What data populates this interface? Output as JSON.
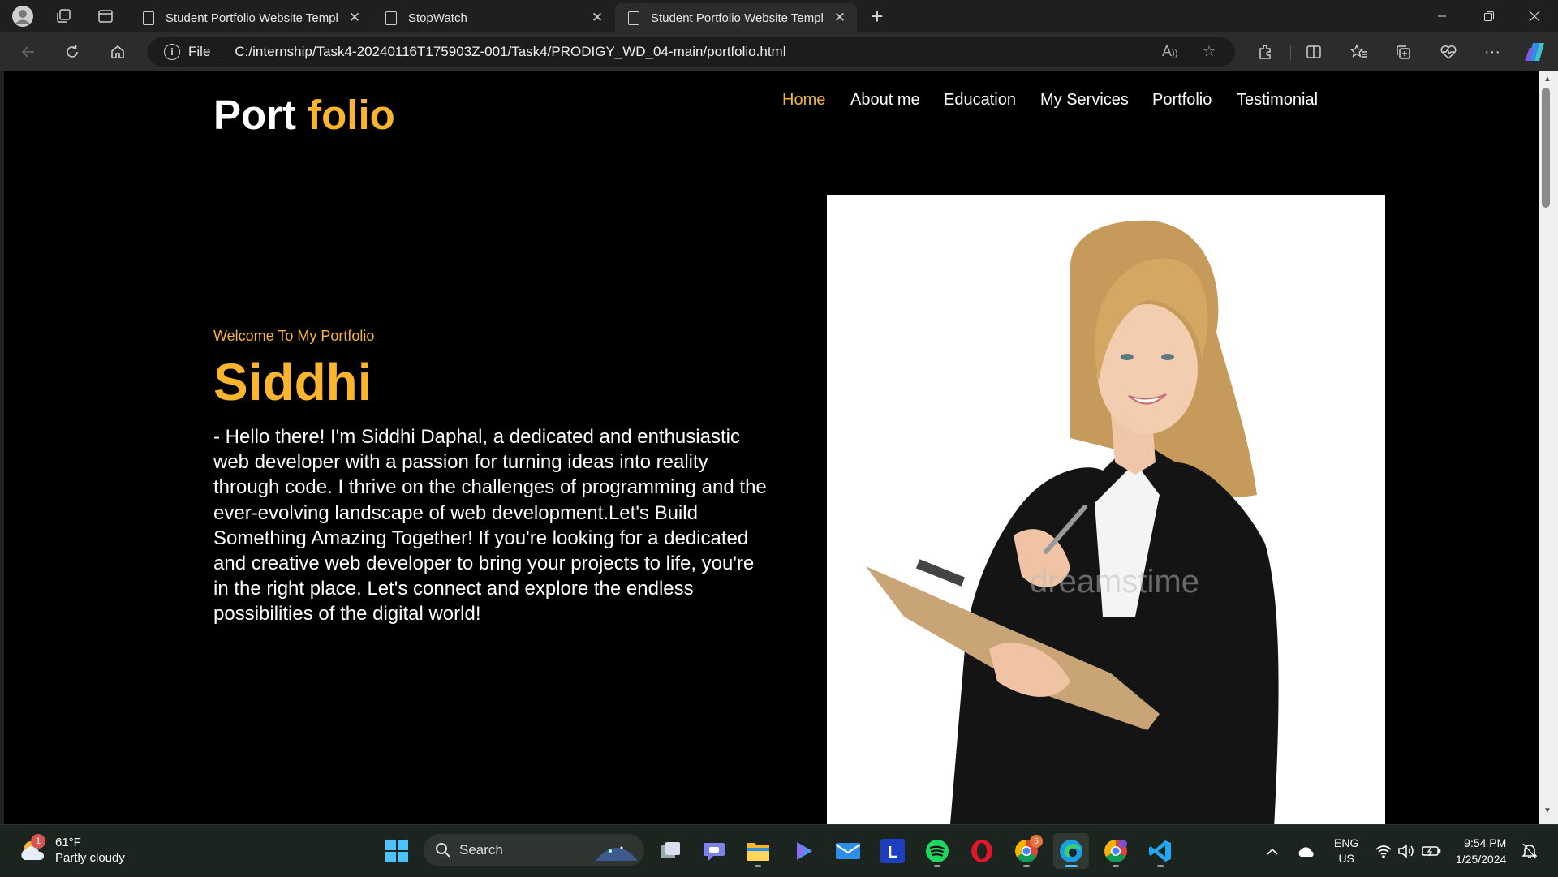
{
  "browser": {
    "tabs": [
      {
        "title": "Student Portfolio Website Templ",
        "active": false
      },
      {
        "title": "StopWatch",
        "active": false
      },
      {
        "title": "Student Portfolio Website Templ",
        "active": true
      }
    ],
    "address": {
      "scheme_label": "File",
      "url": "C:/internship/Task4-20240116T175903Z-001/Task4/PRODIGY_WD_04-main/portfolio.html"
    }
  },
  "page": {
    "logo": {
      "part1": "Port ",
      "part2": "folio"
    },
    "nav": [
      {
        "label": "Home",
        "active": true
      },
      {
        "label": "About me",
        "active": false
      },
      {
        "label": "Education",
        "active": false
      },
      {
        "label": "My Services",
        "active": false
      },
      {
        "label": "Portfolio",
        "active": false
      },
      {
        "label": "Testimonial",
        "active": false
      }
    ],
    "hero": {
      "welcome": "Welcome To My Portfolio",
      "name": "Siddhi",
      "bio": "- Hello there! I'm Siddhi Daphal, a dedicated and enthusiastic web developer with a passion for turning ideas into reality through code. I thrive on the challenges of programming and the ever-evolving landscape of web development.Let's Build Something Amazing Together! If you're looking for a dedicated and creative web developer to bring your projects to life, you're in the right place. Let's connect and explore the endless possibilities of the digital world!"
    },
    "photo_watermark": "dreamstime",
    "accent_color": "#f8b52d"
  },
  "taskbar": {
    "weather": {
      "temp": "61°F",
      "condition": "Partly cloudy",
      "badge": "1"
    },
    "search_placeholder": "Search",
    "chrome_badge": "5",
    "lang": {
      "line1": "ENG",
      "line2": "US"
    },
    "clock": {
      "time": "9:54 PM",
      "date": "1/25/2024"
    }
  }
}
